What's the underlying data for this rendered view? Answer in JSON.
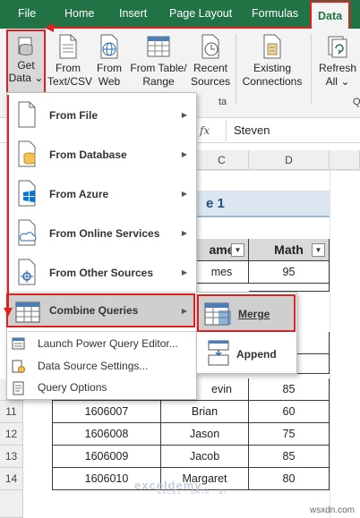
{
  "tabs": [
    {
      "label": "File"
    },
    {
      "label": "Home"
    },
    {
      "label": "Insert"
    },
    {
      "label": "Page Layout"
    },
    {
      "label": "Formulas"
    },
    {
      "label": "Data"
    }
  ],
  "ribbon": {
    "get_data": {
      "line1": "Get",
      "line2": "Data",
      "chevron": "⌄"
    },
    "buttons": [
      {
        "line1": "From",
        "line2": "Text/CSV"
      },
      {
        "line1": "From",
        "line2": "Web"
      },
      {
        "line1": "From Table/",
        "line2": "Range"
      },
      {
        "line1": "Recent",
        "line2": "Sources"
      },
      {
        "line1": "Existing",
        "line2": "Connections"
      },
      {
        "line1": "Refresh",
        "line2": "All",
        "chevron": "⌄"
      }
    ],
    "group_label_fragment": "ta",
    "group_label_fragment2": "Q"
  },
  "formula_bar": {
    "fx": "fx",
    "value": "Steven"
  },
  "sheet": {
    "col_headers": [
      "C",
      "D"
    ],
    "title_fragment": "e 1",
    "header": {
      "name_fragment": "ame",
      "math": "Math"
    },
    "rows": [
      {
        "num": "",
        "id": "",
        "name": "mes",
        "math": "95"
      },
      {
        "num": "",
        "id": "",
        "name": "",
        "math": ""
      },
      {
        "num": "",
        "id": "",
        "name": "",
        "math": ""
      },
      {
        "num": "",
        "id": "",
        "name": "",
        "math": ""
      },
      {
        "num": "",
        "id": "",
        "name": "evin",
        "math": "85"
      },
      {
        "num": "11",
        "id": "1606007",
        "name": "Brian",
        "math": "60"
      },
      {
        "num": "12",
        "id": "1606008",
        "name": "Jason",
        "math": "75"
      },
      {
        "num": "13",
        "id": "1606009",
        "name": "Jacob",
        "math": "85"
      },
      {
        "num": "14",
        "id": "1606010",
        "name": "Margaret",
        "math": "80"
      }
    ]
  },
  "menu": {
    "items": [
      {
        "label": "From File"
      },
      {
        "label": "From Database"
      },
      {
        "label": "From Azure"
      },
      {
        "label": "From Online Services"
      },
      {
        "label": "From Other Sources"
      }
    ],
    "combine": {
      "label": "Combine Queries"
    },
    "simple": [
      {
        "label": "Launch Power Query Editor..."
      },
      {
        "label": "Data Source Settings..."
      },
      {
        "label": "Query Options"
      }
    ],
    "arrow": "▶"
  },
  "submenu": {
    "merge": "Merge",
    "append": "Append"
  },
  "watermark": {
    "brand": "exceldemy",
    "tag": "EXCEL · DATA · BI"
  },
  "site": "wsxdn.com",
  "colors": {
    "excel_green": "#217346",
    "highlight_red": "#e02020",
    "azure_blue": "#0078d4"
  }
}
